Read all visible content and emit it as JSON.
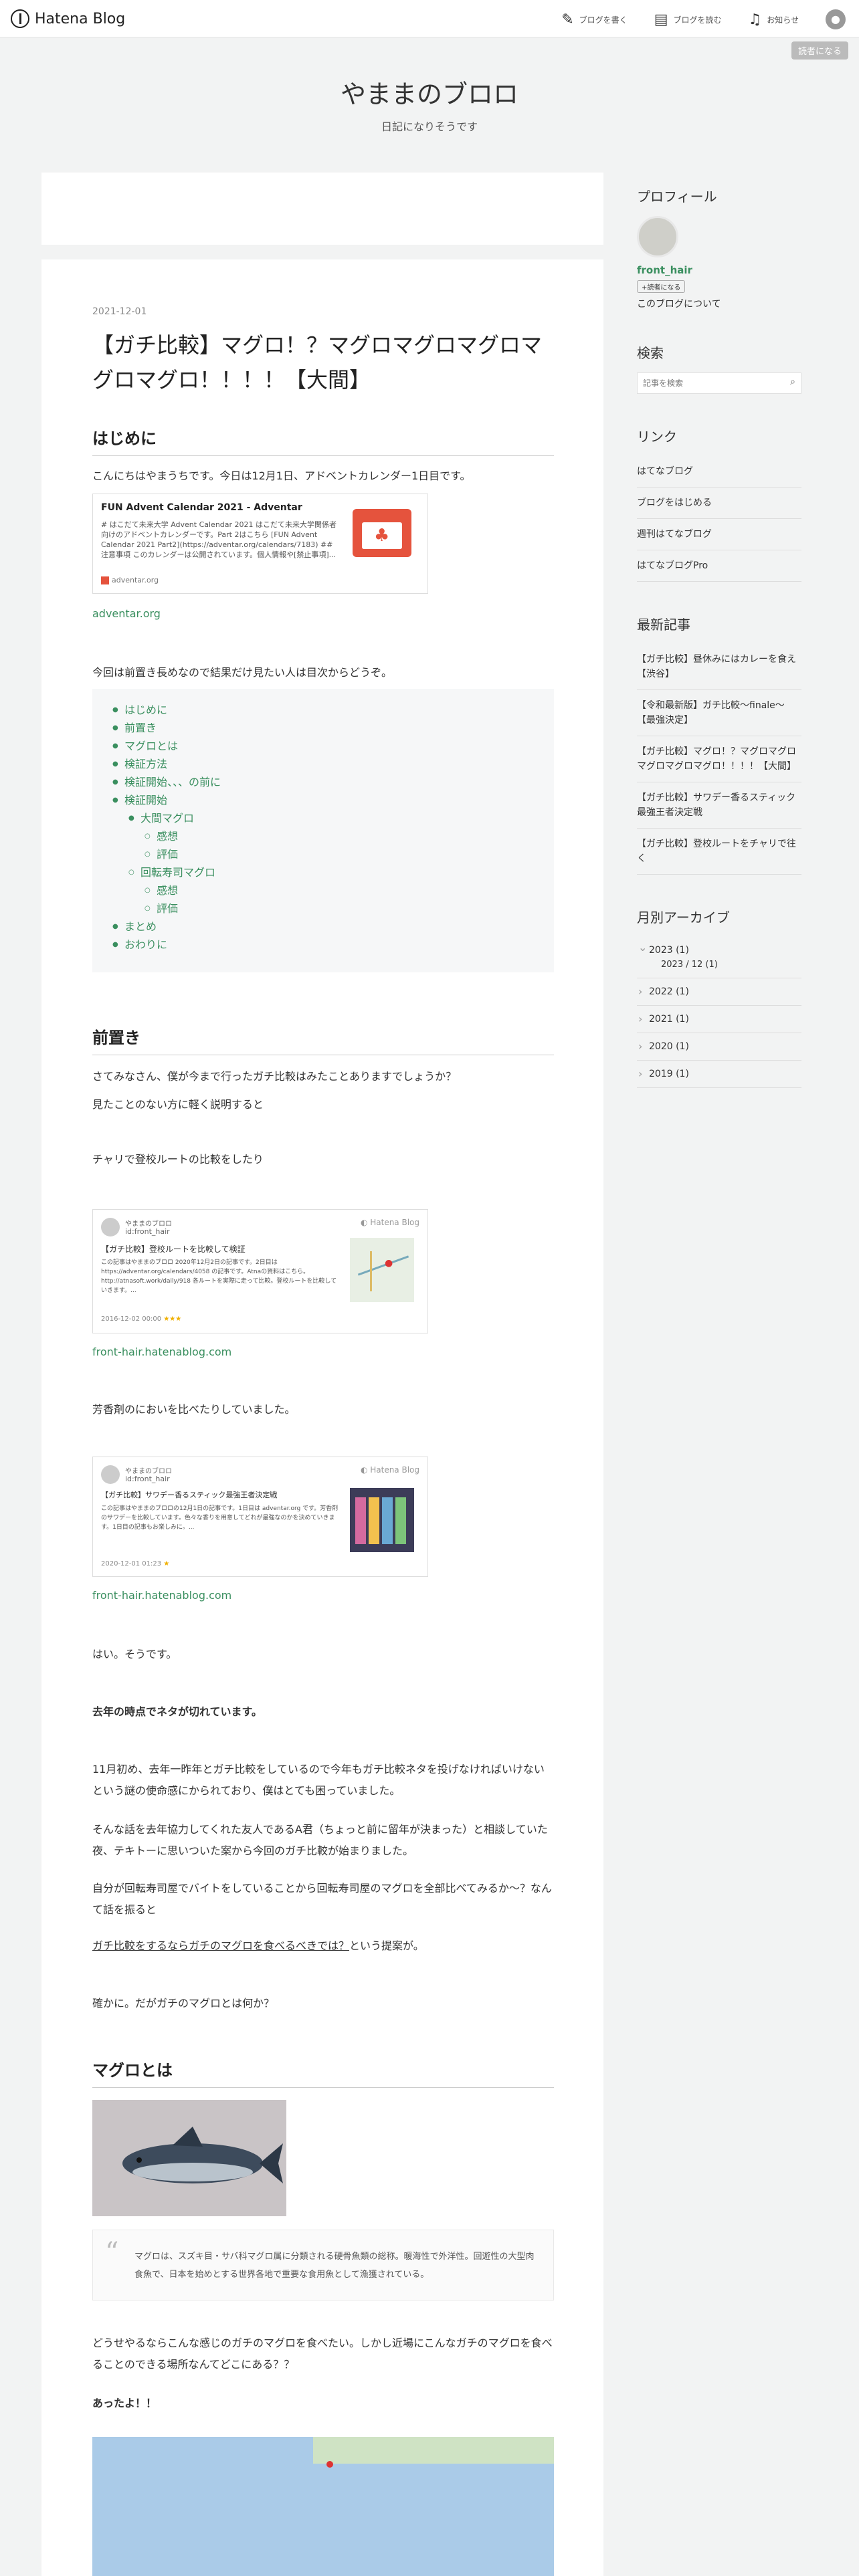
{
  "header": {
    "logo_text": "Hatena Blog",
    "actions": [
      {
        "label": "ブログを書く",
        "icon": "edit-icon"
      },
      {
        "label": "ブログを読む",
        "icon": "reader-icon"
      },
      {
        "label": "お知らせ",
        "icon": "bell-icon"
      }
    ],
    "reader_button": "読者になる"
  },
  "blog": {
    "title": "やままのブロロ",
    "description": "日記になりそうです"
  },
  "article": {
    "date": "2021-12-01",
    "title": "【ガチ比較】マグロ！？マグロマグロマグロマグロマグロ！！！！【大間】",
    "sections": {
      "intro_heading": "はじめに",
      "intro_text": "こんにちはやまうちです。今日は12月1日、アドベントカレンダー1日目です。",
      "card1": {
        "title": "FUN Advent Calendar 2021 - Adventar",
        "desc": "# はこだて未来大学 Advent Calendar 2021 はこだて未来大学関係者向けのアドベントカレンダーです。Part 2はこちら [FUN Advent Calendar 2021 Part2](https://adventar.org/calendars/7183) ## 注意事項 このカレンダーは公開されています。個人情報や[禁止事項]...",
        "site": "adventar.org"
      },
      "link1": "adventar.org",
      "toc_lead": "今回は前置き長めなので結果だけ見たい人は目次からどうぞ。",
      "toc": [
        "はじめに",
        "前置き",
        "マグロとは",
        "検証方法",
        "検証開始、、、の前に",
        "検証開始"
      ],
      "toc_sub1": "大間マグロ",
      "toc_sub1_items": [
        "感想",
        "評価"
      ],
      "toc_sub2": "回転寿司マグロ",
      "toc_sub2_items": [
        "感想",
        "評価"
      ],
      "toc_end": [
        "まとめ",
        "おわりに"
      ],
      "pre_heading": "前置き",
      "pre_p1": "さてみなさん、僕が今まで行ったガチ比較はみたことありますでしょうか？",
      "pre_p2": "見たことのない方に軽く説明すると",
      "pre_p3": "チャリで登校ルートの比較をしたり",
      "card2": {
        "user": "やままのブロロ",
        "id": "id:front_hair",
        "brand": "Hatena Blog",
        "title": "【ガチ比較】登校ルートを比較して検証",
        "desc": "この記事はやままのブロロ 2020年12月2日の記事です。2日目はhttps://adventar.org/calendars/4058 の記事です。Atnaの資料はこちら。http://atnasoft.work/daily/918 各ルートを実際に走って比較。登校ルートを比較していきます。...",
        "date": "2016-12-02 00:00",
        "stars": "★★★"
      },
      "link2": "front-hair.hatenablog.com",
      "pre_p4": "芳香剤のにおいを比べたりしていました。",
      "card3": {
        "user": "やままのブロロ",
        "id": "id:front_hair",
        "brand": "Hatena Blog",
        "title": "【ガチ比較】サワデー香るスティック最強王者決定戦",
        "desc": "この記事はやままのブロロの12月1日の記事です。1日目は adventar.org です。芳香剤のサワデーを比較しています。色々な香りを用意してどれが最強なのかを決めていきます。1日目の記事もお楽しみに。...",
        "date": "2020-12-01 01:23",
        "stars": "★"
      },
      "link3": "front-hair.hatenablog.com",
      "pre_p5": "はい。そうです。",
      "pre_p6": "去年の時点でネタが切れています。",
      "pre_p7": "11月初め、去年一昨年とガチ比較をしているので今年もガチ比較ネタを投げなければいけないという謎の使命感にかられており、僕はとても困っていました。",
      "pre_p8": "そんな話を去年協力してくれた友人であるA君（ちょっと前に留年が決まった）と相談していた夜、テキトーに思いついた案から今回のガチ比較が始まりました。",
      "pre_p9": "自分が回転寿司屋でバイトをしていることから回転寿司屋のマグロを全部比べてみるか～？なんて話を振ると",
      "pre_p10_u": "ガチ比較をするならガチのマグロを食べるべきでは？",
      "pre_p10_t": "という提案が。",
      "pre_p11": "確かに。だがガチのマグロとは何か？",
      "maguro_heading": "マグロとは",
      "quote": "マグロは、スズキ目・サバ科マグロ属に分類される硬骨魚類の総称。暖海性で外洋性。回遊性の大型肉食魚で、日本を始めとする世界各地で重要な食用魚として漁獲されている。",
      "mg_p1": "どうせやるならこんな感じのガチのマグロを食べたい。しかし近場にこんなガチのマグロを食べることのできる場所なんてどこにある？？",
      "mg_p2": "あったよ！！"
    }
  },
  "sidebar": {
    "profile_heading": "プロフィール",
    "profile_name": "front_hair",
    "follow_button": "読者になる",
    "about_link": "このブログについて",
    "search_heading": "検索",
    "search_placeholder": "記事を検索",
    "links_heading": "リンク",
    "links": [
      "はてなブログ",
      "ブログをはじめる",
      "週刊はてなブログ",
      "はてなブログPro"
    ],
    "recent_heading": "最新記事",
    "recent": [
      "【ガチ比較】昼休みにはカレーを食え【渋谷】",
      "【令和最新版】ガチ比較～finale～【最強決定】",
      "【ガチ比較】マグロ！？マグロマグロマグロマグロマグロ！！！！【大間】",
      "【ガチ比較】サワデー香るスティック最強王者決定戦",
      "【ガチ比較】登校ルートをチャリで往く"
    ],
    "archive_heading": "月別アーカイブ",
    "archive": [
      {
        "label": "2023 (1)",
        "open": true
      },
      {
        "label": "2023 / 12 (1)",
        "sub": true
      },
      {
        "label": "2022 (1)"
      },
      {
        "label": "2021 (1)"
      },
      {
        "label": "2020 (1)"
      },
      {
        "label": "2019 (1)"
      }
    ]
  },
  "colors": {
    "link": "#3a8f5f",
    "calendar_red": "#e5533d"
  }
}
